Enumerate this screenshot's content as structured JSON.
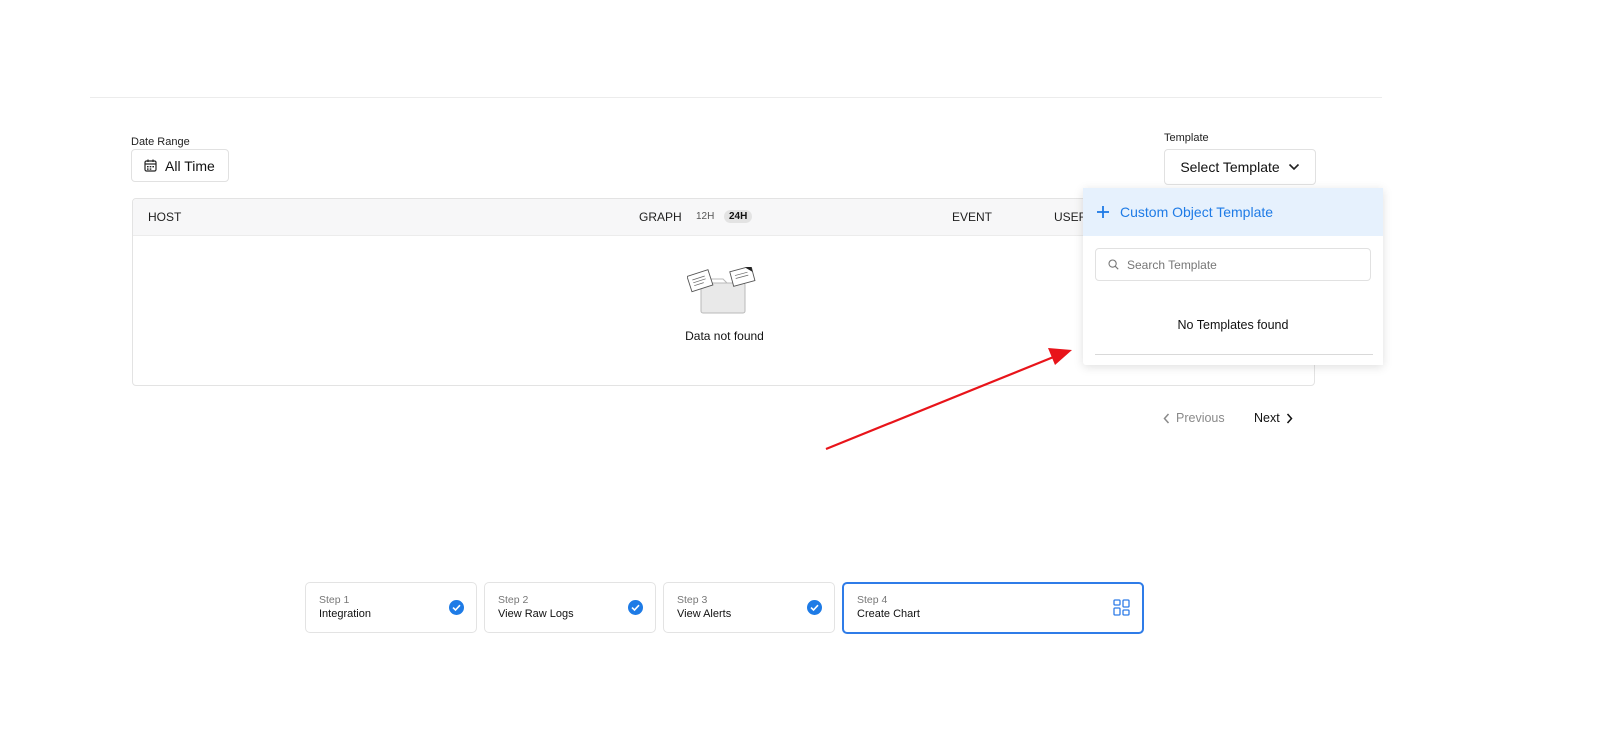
{
  "filters": {
    "date_range_label": "Date Range",
    "date_range_value": "All Time",
    "template_label": "Template",
    "template_value": "Select Template"
  },
  "table": {
    "columns": {
      "host": "HOST",
      "graph": "GRAPH",
      "range_12h": "12H",
      "range_24h": "24H",
      "event": "EVENT",
      "user": "USER"
    },
    "active_range": "24H",
    "empty_text": "Data not found"
  },
  "template_dropdown": {
    "custom_label": "Custom Object Template",
    "search_placeholder": "Search Template",
    "empty_text": "No Templates found"
  },
  "pagination": {
    "previous": "Previous",
    "next": "Next"
  },
  "steps": [
    {
      "number": "Step 1",
      "name": "Integration",
      "status": "complete"
    },
    {
      "number": "Step 2",
      "name": "View Raw Logs",
      "status": "complete"
    },
    {
      "number": "Step 3",
      "name": "View Alerts",
      "status": "complete"
    },
    {
      "number": "Step 4",
      "name": "Create Chart",
      "status": "current"
    }
  ],
  "colors": {
    "accent": "#2f7ce8",
    "link": "#1e7be6",
    "dropdown_highlight": "#e6f1fd",
    "annotation_arrow": "#e8141a"
  },
  "icons": {
    "date": "calendar-icon",
    "template": "chevron-down-icon",
    "custom": "plus-icon",
    "search": "search-icon",
    "empty": "empty-folder-icon",
    "step_complete": "check-circle-icon",
    "step_current": "grid-icon"
  }
}
